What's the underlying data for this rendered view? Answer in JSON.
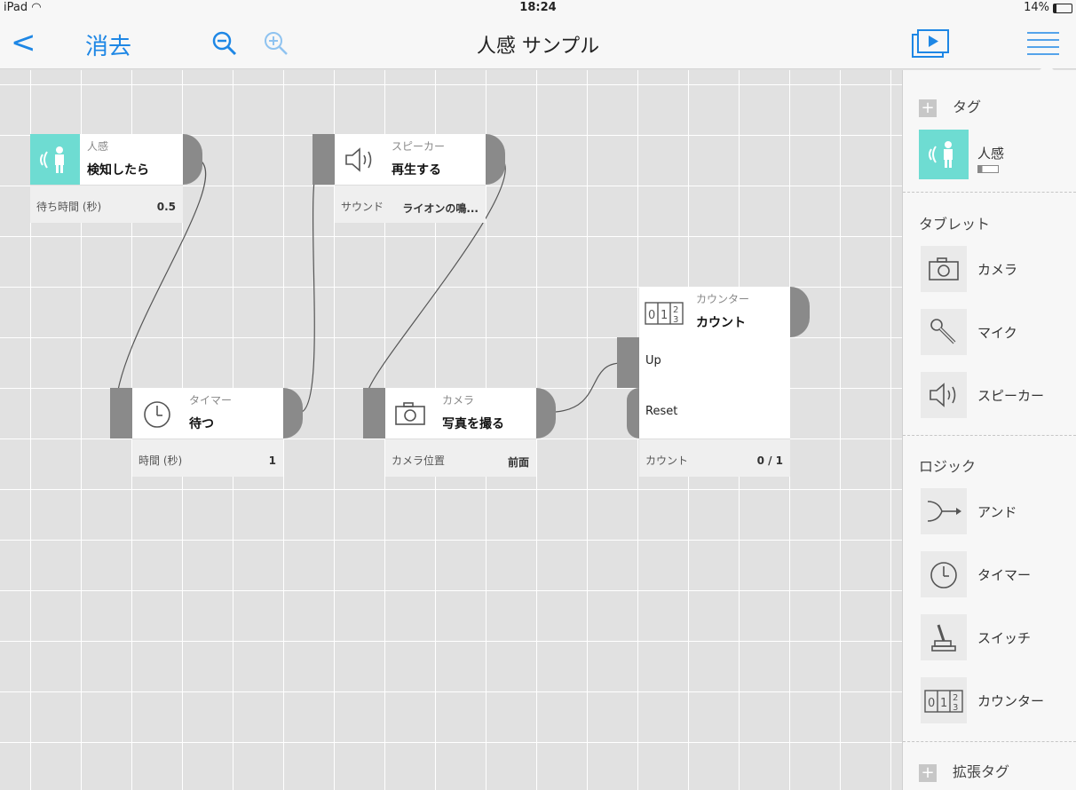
{
  "status": {
    "device": "iPad",
    "time": "18:24",
    "battery": "14%"
  },
  "nav": {
    "back": "<",
    "delete": "消去",
    "title": "人感 サンプル"
  },
  "blocks": {
    "motion": {
      "type": "人感",
      "action": "検知したら",
      "param_key": "待ち時間 (秒)",
      "param_value": "0.5"
    },
    "speaker": {
      "type": "スピーカー",
      "action": "再生する",
      "param_key": "サウンド",
      "param_value": "ライオンの鳴..."
    },
    "timer": {
      "type": "タイマー",
      "action": "待つ",
      "param_key": "時間 (秒)",
      "param_value": "1"
    },
    "camera": {
      "type": "カメラ",
      "action": "写真を撮る",
      "param_key": "カメラ位置",
      "param_value": "前面"
    },
    "counter": {
      "type": "カウンター",
      "action": "カウント",
      "input_up": "Up",
      "input_reset": "Reset",
      "param_key": "カウント",
      "param_value": "0 / 1"
    }
  },
  "sidebar": {
    "tags": {
      "header": "タグ",
      "items": [
        {
          "label": "人感",
          "icon": "motion-sensor-icon"
        }
      ]
    },
    "tablet": {
      "header": "タブレット",
      "items": [
        {
          "label": "カメラ",
          "icon": "camera-icon"
        },
        {
          "label": "マイク",
          "icon": "microphone-icon"
        },
        {
          "label": "スピーカー",
          "icon": "speaker-icon"
        }
      ]
    },
    "logic": {
      "header": "ロジック",
      "items": [
        {
          "label": "アンド",
          "icon": "and-icon"
        },
        {
          "label": "タイマー",
          "icon": "timer-icon"
        },
        {
          "label": "スイッチ",
          "icon": "switch-icon"
        },
        {
          "label": "カウンター",
          "icon": "counter-icon"
        }
      ]
    },
    "extension": {
      "header": "拡張タグ"
    }
  },
  "colors": {
    "accent": "#1e87e5",
    "sensor_teal": "#6edcd2",
    "port_gray": "#8a8a8a"
  }
}
